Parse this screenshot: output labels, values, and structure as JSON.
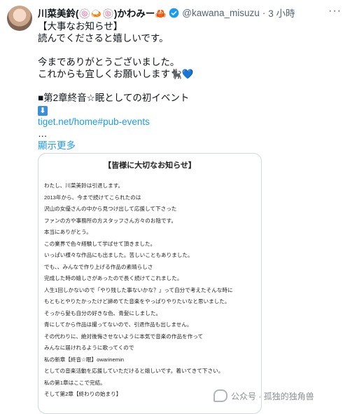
{
  "tweet": {
    "name": "川菜美鈴(🍥🍛🍥)かわみー🦀",
    "handle": "@kawana_misuzu",
    "dot": "·",
    "time": "3 小時",
    "more_icon": "more-horizontal-icon",
    "lines": {
      "l1": "【大事なお知らせ】",
      "l2": "読んでくださると嬉しいです。",
      "l3": "今までありがとうございました。",
      "l4": "これからも宜しくお願いします",
      "l4_emoji": "🐈‍⬛",
      "l4_heart": "💙",
      "l5": "■第2章終音☆眠としての初イベント",
      "arrow": "⬇",
      "link": "tiget.net/home#pub-events",
      "ellipsis": "…",
      "show_more": "顯示更多"
    }
  },
  "card": {
    "title": "【皆様に大切なお知らせ】",
    "lines": [
      "わたし、川菜美鈴は引退します。",
      "2013年から、今まで続けてこられたのは",
      "沢山の女優さんの中から見つけ出して応援して下さった",
      "ファンの方や事務所の方スタッフさん方々のお陰です。",
      "本当にありがとう。",
      "この業界で色々経験して学ばせて頂きました。",
      "いっぱい様々な作品にも出ました。苦しいこともありました。",
      "でも、、みんなで作り上げる作品の素晴らしさ",
      "完成した時の嬉しさがあったので長く続けてこれました。",
      "人生1回しかないので「やり残した事ないかな？」って自分で考えたそんな時に",
      "もともとやりたかったけど諦めてた音楽をやっぱりやりたいなと思いました。",
      "そっから髪も自分の好きな色、青髪にしました。",
      "青にしてから作品は撮ってないので、引退作品も出しません。",
      "その代わりに、絶対後悔させないように本気で音楽の作品を作って",
      "みんなに届けれるように歌ってくので",
      "私の新章【終音☆眠】owarinemin",
      "としての音楽活動を応援していただけると嬉しいです。着いてきて下さい。",
      "私の第1章はここで完結。",
      "そして第2章【終わりの始まり】"
    ]
  },
  "watermark": {
    "text": "公众号 · 孤独的独角兽"
  },
  "colors": {
    "link": "#1d9bf0",
    "text": "#0f1419",
    "secondary": "#536471",
    "verified": "#1d9bf0"
  }
}
